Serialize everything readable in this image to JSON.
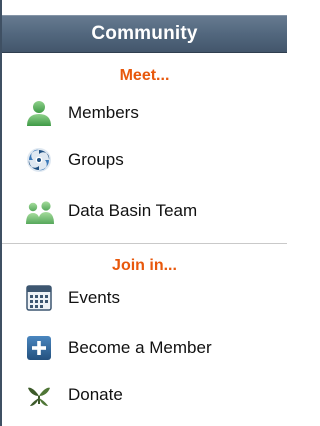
{
  "header": {
    "title": "Community"
  },
  "sections": [
    {
      "title": "Meet...",
      "items": [
        {
          "label": "Members",
          "icon": "person-icon"
        },
        {
          "label": "Groups",
          "icon": "groups-swirl-icon"
        },
        {
          "label": "Data Basin Team",
          "icon": "team-icon"
        }
      ]
    },
    {
      "title": "Join in...",
      "items": [
        {
          "label": "Events",
          "icon": "calendar-icon"
        },
        {
          "label": "Become a Member",
          "icon": "plus-icon"
        },
        {
          "label": "Donate",
          "icon": "donate-plant-icon"
        }
      ]
    }
  ],
  "colors": {
    "header_bg": "#52677e",
    "section_title": "#e8580c",
    "icon_green": "#6db56d",
    "icon_blue": "#2d5f8f"
  }
}
